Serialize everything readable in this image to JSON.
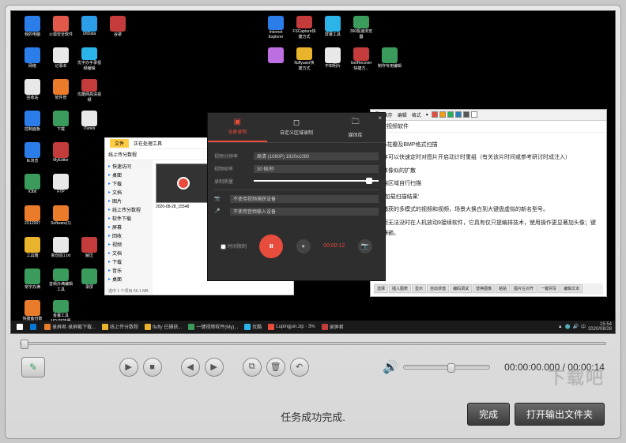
{
  "desktop": {
    "left_icons": [
      {
        "label": "我的电脑",
        "color": "#2b7de9"
      },
      {
        "label": "火狐安全软件",
        "color": "#e2584a"
      },
      {
        "label": "UltData",
        "color": "#2b9de9"
      },
      {
        "label": "谷歌",
        "color": "#c43b3b"
      },
      {
        "label": "",
        "color": "#000"
      },
      {
        "label": "",
        "color": "#000"
      },
      {
        "label": "网络",
        "color": "#2b7de9"
      },
      {
        "label": "记事本",
        "color": "#e8e8e8"
      },
      {
        "label": "优字办手录视频编辑",
        "color": "#2bb4e9"
      },
      {
        "label": "",
        "color": "#000"
      },
      {
        "label": "",
        "color": "#000"
      },
      {
        "label": "",
        "color": "#000"
      },
      {
        "label": "回收站",
        "color": "#e8e8e8"
      },
      {
        "label": "软件管",
        "color": "#e97b2b"
      },
      {
        "label": "优酷网高清视频",
        "color": "#c43b3b"
      },
      {
        "label": "",
        "color": "#000"
      },
      {
        "label": "",
        "color": "#000"
      },
      {
        "label": "",
        "color": "#000"
      },
      {
        "label": "控制面板",
        "color": "#2b7de9"
      },
      {
        "label": "下载",
        "color": "#3a9b5c"
      },
      {
        "label": "iTunes",
        "color": "#e8e8e8"
      },
      {
        "label": "",
        "color": "#000"
      },
      {
        "label": "",
        "color": "#000"
      },
      {
        "label": "",
        "color": "#000"
      },
      {
        "label": "IE浏览",
        "color": "#2b7de9"
      },
      {
        "label": "MyEditor",
        "color": "#c43b3b"
      },
      {
        "label": "",
        "color": "#000"
      },
      {
        "label": "",
        "color": "#000"
      },
      {
        "label": "",
        "color": "#000"
      },
      {
        "label": "",
        "color": "#000"
      },
      {
        "label": "iObit",
        "color": "#3a9b5c"
      },
      {
        "label": "FTP",
        "color": "#e8e8e8"
      },
      {
        "label": "",
        "color": "#000"
      },
      {
        "label": "",
        "color": "#000"
      },
      {
        "label": "",
        "color": "#000"
      },
      {
        "label": "",
        "color": "#000"
      },
      {
        "label": "2X12007",
        "color": "#e97b2b"
      },
      {
        "label": "Software(1)",
        "color": "#e97b2b"
      },
      {
        "label": "",
        "color": "#000"
      },
      {
        "label": "",
        "color": "#000"
      },
      {
        "label": "",
        "color": "#000"
      },
      {
        "label": "",
        "color": "#000"
      },
      {
        "label": "工具箱",
        "color": "#e9b42b"
      },
      {
        "label": "新创造1.txt",
        "color": "#e8e8e8"
      },
      {
        "label": "解压",
        "color": "#c43b3b"
      },
      {
        "label": "",
        "color": "#000"
      },
      {
        "label": "",
        "color": "#000"
      },
      {
        "label": "",
        "color": "#000"
      },
      {
        "label": "常字办满",
        "color": "#3a9b5c"
      },
      {
        "label": "音频办满编辑工具",
        "color": "#3a9b5c"
      },
      {
        "label": "录屏",
        "color": "#3a9b5c"
      },
      {
        "label": "",
        "color": "#000"
      },
      {
        "label": "",
        "color": "#000"
      },
      {
        "label": "",
        "color": "#000"
      },
      {
        "label": "快捷备份数",
        "color": "#e97b2b"
      },
      {
        "label": "金薯工具MP4转换器",
        "color": "#3a9b5c"
      }
    ],
    "top_icons": [
      {
        "label": "Internet Explorer",
        "color": "#2b7de9"
      },
      {
        "label": "FSCapture快捷方式",
        "color": "#c43b3b"
      },
      {
        "label": "屏幕工具",
        "color": "#2bb4e9"
      },
      {
        "label": "360极速浏览器",
        "color": "#3a9b5c"
      },
      {
        "label": "",
        "color": "#000"
      },
      {
        "label": "",
        "color": "#bd6fe2"
      },
      {
        "label": "fluffyuser快捷方式",
        "color": "#e9b42b"
      },
      {
        "label": "不知明片",
        "color": "#e8e8e8"
      },
      {
        "label": "GetRecover快捷方...",
        "color": "#c43b3b"
      },
      {
        "label": "制作专用编辑",
        "color": "#3a9b5c"
      }
    ]
  },
  "recorder": {
    "title_close": "×",
    "tabs": [
      "全屏录制",
      "自定义区域录制",
      "媒体库"
    ],
    "rows": [
      {
        "label": "视频分辨率",
        "value": "高清 (1080P)  1920x1080"
      },
      {
        "label": "视频帧率",
        "value": "30 帧/秒"
      },
      {
        "label": "录制质量",
        "value": ""
      }
    ],
    "dev_rows": [
      {
        "icon": "📷",
        "value": "不使用视频捕获设备"
      },
      {
        "icon": "🎤",
        "value": "不使用音频输入设备"
      }
    ],
    "time_limit": "时间限制",
    "time": "00:00:12"
  },
  "fileexp": {
    "tab": "文件",
    "toolbar": "正在处理工具",
    "path": "线上传分数程",
    "side": [
      "快速访问",
      "桌面",
      "下载",
      "文档",
      "图片",
      "线上传分数程",
      "软件下载",
      "屏幕",
      "回收",
      "视频",
      "文档",
      "下载",
      "音乐",
      "桌面"
    ],
    "thumb_label": "2020-08-28_15548",
    "footer": "选中 1 个项目  66.1 MB"
  },
  "doc": {
    "title": "一键视频软件",
    "toolbar": [
      "F",
      "保存",
      "编辑",
      "格式",
      "▾"
    ],
    "color_swatches": [
      "#e84c3d",
      "#f39c12",
      "#27ae60",
      "#2980b9",
      "#555",
      "#fff"
    ],
    "lines": [
      "JPA花瓣及BMP格式扫描",
      "程序可以快速定时对图片开启动计时重组（有关该片时间或参考研讨时成注入）",
      "媒体像似的扩散",
      "扫描区域自行扫描",
      "'和'加载扫描结果'",
      "键捕获的多模式的视频和视频，场景大换白到大键盘虚拟的新名型号。",
      "使用无法没时在人机放动9接续软件，它具有仅只提编排技术，使用操作更显著加头像；键盘镶嵌。"
    ],
    "footer_btns": [
      "选择",
      "插入图表",
      "显示",
      "自动求值",
      "编码调试",
      "替换图像",
      "粘贴",
      "图片左对齐",
      "一键另写",
      "编辑文本"
    ]
  },
  "taskbar": {
    "items": [
      {
        "label": "",
        "color": "#0078d4"
      },
      {
        "label": "录屏君·录屏截下载...",
        "color": "#e97b2b"
      },
      {
        "label": "线上传分数程",
        "color": "#e9b42b"
      },
      {
        "label": "fluffy  已捕获...",
        "color": "#e9b42b"
      },
      {
        "label": "一键视频软件(My)...",
        "color": "#3a9b5c"
      },
      {
        "label": "优酷",
        "color": "#2bb4e9"
      },
      {
        "label": "Lupingjun.zip · 3%",
        "color": "#e84c3d"
      },
      {
        "label": "录屏君",
        "color": "#c43b3b"
      }
    ],
    "time": "15:54",
    "date": "2020/08/28"
  },
  "player": {
    "time_current": "00:00:00.000",
    "time_total": "00:00:14"
  },
  "status": {
    "message": "任务成功完成.",
    "watermark": "下载吧"
  },
  "actions": {
    "done": "完成",
    "open_folder": "打开输出文件夹"
  }
}
